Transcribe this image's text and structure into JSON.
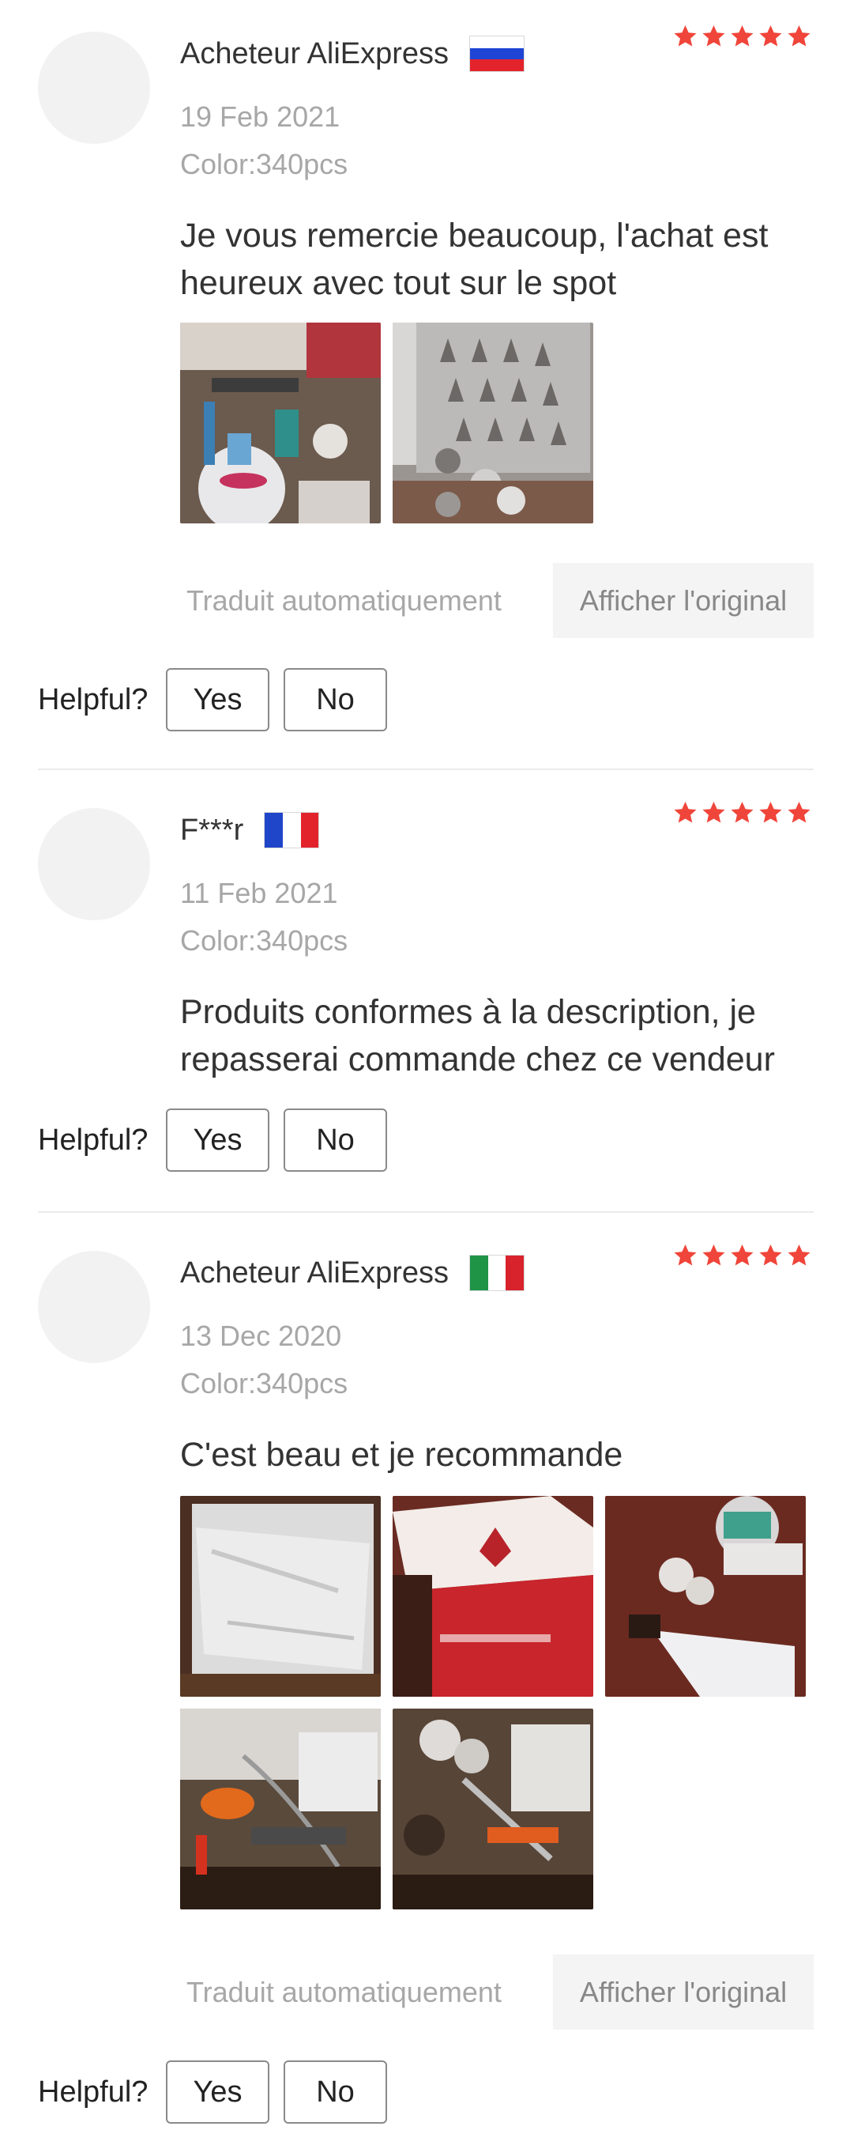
{
  "ui": {
    "translated_label": "Traduit automatiquement",
    "show_original": "Afficher l'original",
    "helpful": "Helpful?",
    "yes": "Yes",
    "no": "No"
  },
  "colors": {
    "star": "#f0453a",
    "muted_text": "#a7a7a7",
    "text": "#333333"
  },
  "reviews": [
    {
      "author": "Acheteur AliExpress",
      "country": "RU",
      "rating": 5,
      "date": "19 Feb 2021",
      "sku": "Color:340pcs",
      "text": "Je vous remercie beaucoup, l'achat est heureux avec tout sur le spot",
      "photos": [
        "review-photo-decorating-kit",
        "review-photo-piping-tips"
      ]
    },
    {
      "author": "F***r",
      "country": "FR",
      "rating": 5,
      "date": "11 Feb 2021",
      "sku": "Color:340pcs",
      "text": "Produits conformes à la description, je repasserai commande chez ce vendeur",
      "photos": []
    },
    {
      "author": "Acheteur AliExpress",
      "country": "IT",
      "rating": 5,
      "date": "13 Dec 2020",
      "sku": "Color:340pcs",
      "text": "C'est beau et je recommande",
      "photos": [
        "review-photo-package",
        "review-photo-red-box",
        "review-photo-items",
        "review-photo-whisk",
        "review-photo-tools"
      ]
    }
  ]
}
